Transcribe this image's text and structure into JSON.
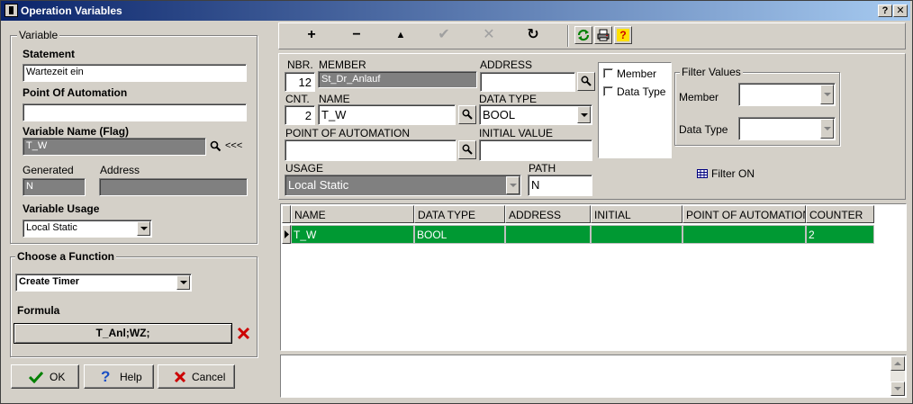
{
  "window": {
    "title": "Operation Variables"
  },
  "titlebar_buttons": {
    "help": "?",
    "close": "✕"
  },
  "variable": {
    "group_title": "Variable",
    "statement_label": "Statement",
    "statement_value": "Wartezeit ein",
    "poa_label": "Point Of Automation",
    "poa_value": "",
    "varname_label": "Variable Name (Flag)",
    "varname_value": "T_W",
    "more": "<<<",
    "generated_label": "Generated",
    "generated_value": "N",
    "address_label": "Address",
    "address_value": "",
    "usage_label": "Variable Usage",
    "usage_value": "Local Static"
  },
  "function": {
    "group_title": "Choose a Function",
    "selected": "Create Timer",
    "formula_label": "Formula",
    "formula_value": "T_Anl;WZ;"
  },
  "buttons": {
    "ok": "OK",
    "help": "Help",
    "cancel": "Cancel"
  },
  "toolbar": {
    "add": "+",
    "remove": "−",
    "move_up": "▲",
    "confirm": "✔",
    "delete": "✕",
    "redo": "↻"
  },
  "editor": {
    "nbr_label": "NBR.",
    "nbr_value": "12",
    "member_label": "MEMBER",
    "member_value": "St_Dr_Anlauf",
    "address_label": "ADDRESS",
    "address_value": "",
    "cnt_label": "CNT.",
    "cnt_value": "2",
    "name_label": "NAME",
    "name_value": "T_W",
    "datatype_label": "DATA TYPE",
    "datatype_value": "BOOL",
    "poa_label": "POINT OF AUTOMATION",
    "poa_value": "",
    "initial_label": "INITIAL VALUE",
    "initial_value": "",
    "usage_label": "USAGE",
    "usage_value": "Local Static",
    "path_label": "PATH",
    "path_value": "N"
  },
  "filter": {
    "member_check": "Member",
    "datatype_check": "Data Type",
    "group_title": "Filter Values",
    "member_label": "Member",
    "datatype_label": "Data Type",
    "member_value": "",
    "datatype_value": "",
    "status": "Filter ON"
  },
  "table": {
    "columns": [
      "NAME",
      "DATA TYPE",
      "ADDRESS",
      "INITIAL",
      "POINT OF AUTOMATION",
      "COUNTER"
    ],
    "rows": [
      {
        "name": "T_W",
        "data_type": "BOOL",
        "address": "",
        "initial": "",
        "poa": "",
        "counter": "2"
      }
    ]
  },
  "colors": {
    "title_start": "#0a246a",
    "title_end": "#a6caf0",
    "row_selected": "#009933",
    "cancel_x": "#cc0000",
    "ok_check": "#008000",
    "help_q": "#1a4fc4"
  }
}
